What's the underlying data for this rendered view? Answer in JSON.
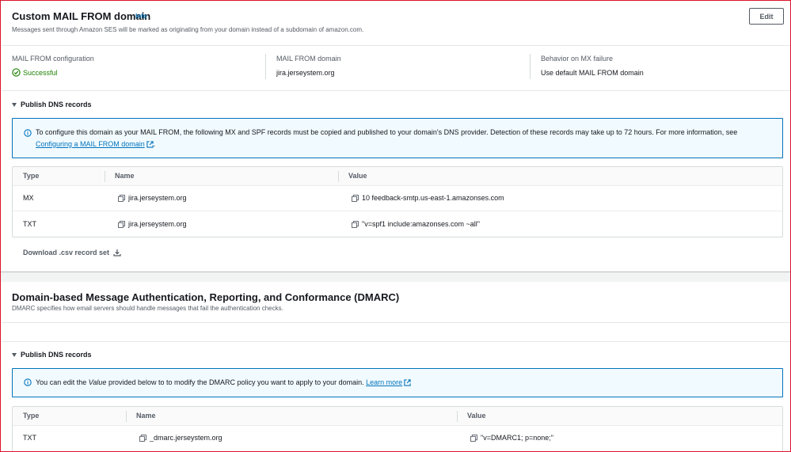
{
  "mail_from": {
    "title": "Custom MAIL FROM domain",
    "info_label": "Info",
    "description": "Messages sent through Amazon SES will be marked as originating from your domain instead of a subdomain of amazon.com.",
    "edit_label": "Edit",
    "config_label": "MAIL FROM configuration",
    "config_value": "Successful",
    "domain_label": "MAIL FROM domain",
    "domain_value": "jira.jerseystem.org",
    "behavior_label": "Behavior on MX failure",
    "behavior_value": "Use default MAIL FROM domain",
    "publish_label": "Publish DNS records",
    "alert_text_1": "To configure this domain as your MAIL FROM, the following MX and SPF records must be copied and published to your domain's DNS provider. Detection of these records may take up to 72 hours. For more information, see",
    "alert_link": "Configuring a MAIL FROM domain",
    "alert_text_2": ".",
    "table": {
      "headers": [
        "Type",
        "Name",
        "Value"
      ],
      "rows": [
        {
          "type": "MX",
          "name": "jira.jerseystem.org",
          "value": "10 feedback-smtp.us-east-1.amazonses.com"
        },
        {
          "type": "TXT",
          "name": "jira.jerseystem.org",
          "value": "\"v=spf1 include:amazonses.com ~all\""
        }
      ]
    },
    "download_label": "Download .csv record set"
  },
  "dmarc": {
    "title": "Domain-based Message Authentication, Reporting, and Conformance (DMARC)",
    "description": "DMARC specifies how email servers should handle messages that fail the authentication checks.",
    "publish_label": "Publish DNS records",
    "alert_text_1": "You can edit the",
    "alert_italic": "Value",
    "alert_text_2": "provided below to to modify the DMARC policy you want to apply to your domain.",
    "alert_link": "Learn more",
    "table": {
      "headers": [
        "Type",
        "Name",
        "Value"
      ],
      "rows": [
        {
          "type": "TXT",
          "name": "_dmarc.jerseystem.org",
          "value": "\"v=DMARC1; p=none;\""
        }
      ]
    }
  },
  "colors": {
    "link": "#0073bb",
    "success": "#1d8102",
    "alert_bg": "#f1faff",
    "frame": "#d9142b"
  },
  "icons": [
    "info-circle-icon",
    "success-check-icon",
    "copy-icon",
    "external-link-icon",
    "download-icon",
    "caret-down-icon"
  ]
}
